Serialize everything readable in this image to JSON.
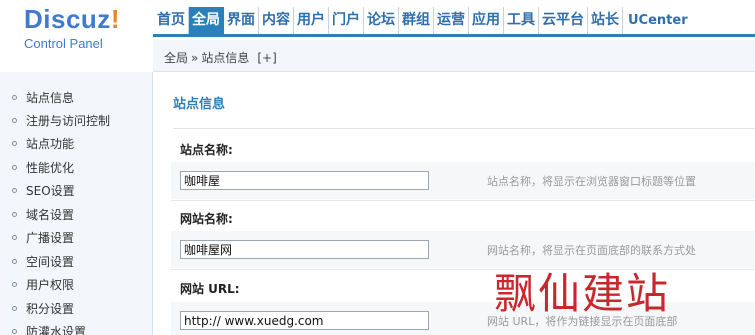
{
  "logo": {
    "title": "Discuz",
    "bang": "!",
    "subtitle": "Control Panel"
  },
  "topnav": {
    "items": [
      "首页",
      "全局",
      "界面",
      "内容",
      "用户",
      "门户",
      "论坛",
      "群组",
      "运营",
      "应用",
      "工具",
      "云平台",
      "站长",
      "UCenter"
    ],
    "active_index": 1
  },
  "breadcrumb": {
    "parts": [
      "全局",
      "站点信息"
    ],
    "separator": "»",
    "add_label": "[+]"
  },
  "sidebar": {
    "items": [
      {
        "label": "站点信息"
      },
      {
        "label": "注册与访问控制"
      },
      {
        "label": "站点功能"
      },
      {
        "label": "性能优化"
      },
      {
        "label": "SEO设置"
      },
      {
        "label": "域名设置"
      },
      {
        "label": "广播设置"
      },
      {
        "label": "空间设置"
      },
      {
        "label": "用户权限"
      },
      {
        "label": "积分设置"
      },
      {
        "label": "防灌水设置"
      }
    ]
  },
  "main": {
    "section_title": "站点信息",
    "fields": [
      {
        "label": "站点名称:",
        "value": "咖啡屋",
        "tip": "站点名称，将显示在浏览器窗口标题等位置"
      },
      {
        "label": "网站名称:",
        "value": "咖啡屋网",
        "tip": "网站名称，将显示在页面底部的联系方式处"
      },
      {
        "label": "网站 URL:",
        "value": "http:// www.xuedg.com",
        "tip": "网站 URL，将作为链接显示在页面底部"
      }
    ]
  },
  "watermark": "飘仙建站",
  "colors": {
    "accent": "#2a80b9",
    "logo": "#3f7ad1",
    "logo_bang": "#e0892b",
    "watermark": "#c4161c"
  }
}
